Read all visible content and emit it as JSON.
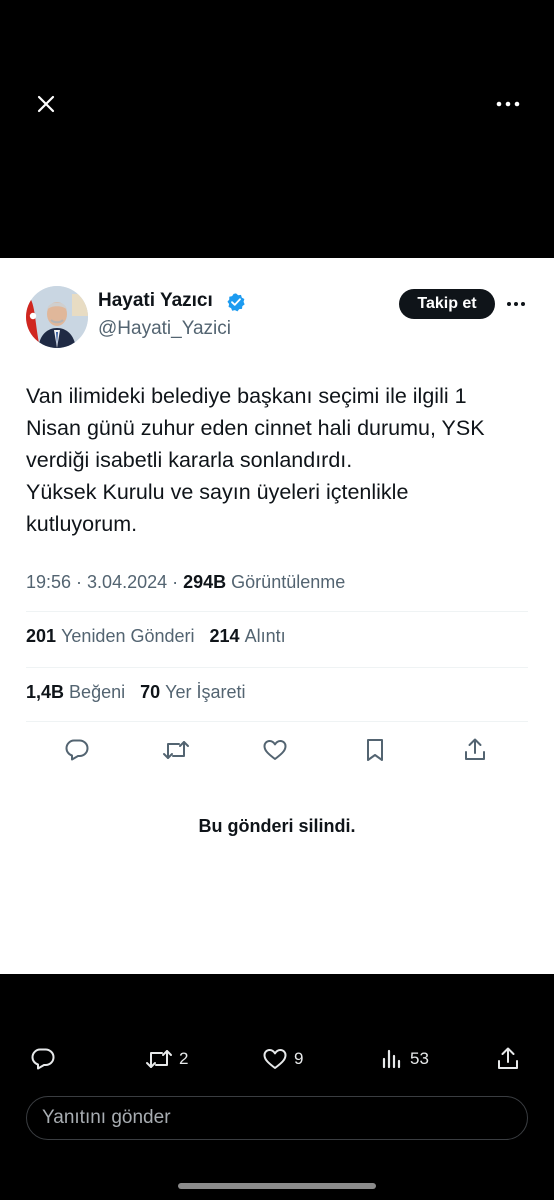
{
  "author": {
    "name": "Hayati Yazıcı",
    "handle": "@Hayati_Yazici",
    "follow_label": "Takip et"
  },
  "tweet": {
    "lines": [
      "Van ilimideki belediye başkanı seçimi ile ilgili 1",
      "Nisan günü zuhur eden cinnet hali durumu, YSK",
      "verdiği isabetli kararla sonlandırdı.",
      "Yüksek Kurulu ve sayın üyeleri içtenlikle",
      "kutluyorum."
    ],
    "timestamp": "19:56 · 3.04.2024 · ",
    "views_count": "294B",
    "views_label": "Görüntülenme"
  },
  "stats": {
    "reposts_count": "201",
    "reposts_label": "Yeniden Gönderi",
    "quotes_count": "214",
    "quotes_label": "Alıntı",
    "likes_count": "1,4B",
    "likes_label": "Beğeni",
    "bookmarks_count": "70",
    "bookmarks_label": "Yer İşareti"
  },
  "deleted_message": "Bu gönderi silindi.",
  "bottom_bar": {
    "reposts": "2",
    "likes": "9",
    "views": "53",
    "reply_placeholder": "Yanıtını gönder"
  },
  "icons": {
    "close": "close-icon",
    "more": "more-icon",
    "verified": "verified-badge-icon",
    "reply": "reply-icon",
    "repost": "repost-icon",
    "like": "heart-icon",
    "bookmark": "bookmark-icon",
    "share": "share-icon",
    "views": "views-icon"
  },
  "colors": {
    "verified_blue": "#1d9bf0",
    "text_primary": "#0f1419",
    "text_secondary": "#536471",
    "background_dark": "#000000"
  }
}
